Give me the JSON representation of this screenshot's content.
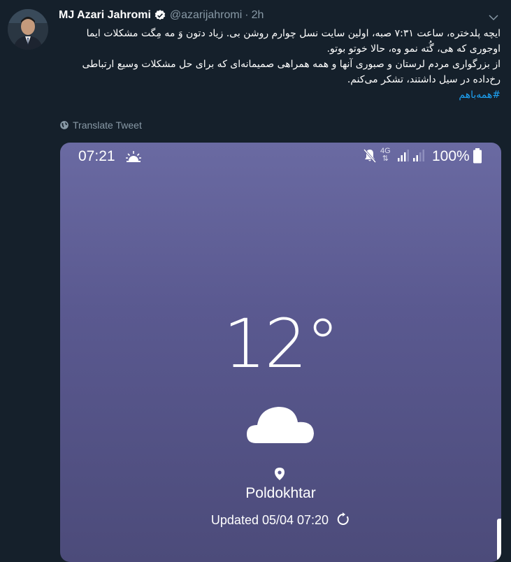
{
  "tweet": {
    "author_name": "MJ Azari Jahromi",
    "handle": "@azarijahromi",
    "separator": "·",
    "time": "2h",
    "text_line1": "ایچه پلدختره، ساعت ۷:۳۱ صبه، اولین سایت نسل چوارم روشن بی. زیاد دتون وَ مه مِگت مشکلات ایما",
    "text_line2": "اوجوری که هی، گُته نمو وه، حالا خوتو بوتو.",
    "text_line3": "از بزرگواری مردم لرستان و صبوری آنها و همه همراهی صمیمانه‌ای که برای حل مشکلات وسیع ارتباطی",
    "text_line4": "رخ‌داده در سیل داشتند، تشکر می‌کنم.",
    "hashtag": "#همه‌باهم",
    "translate_label": "Translate Tweet"
  },
  "phone": {
    "status_time": "07:21",
    "network_label": "4G",
    "battery": "100%",
    "temperature": "12°",
    "location": "Poldokhtar",
    "updated": "Updated 05/04 07:20"
  },
  "colors": {
    "background": "#15202b",
    "link": "#1da1f2",
    "muted": "#8899a6",
    "verified": "#ffffff",
    "weather_top": "#6a6aa2",
    "weather_bottom": "#4c4b7a"
  },
  "icons": {
    "verified": "verified-badge-icon",
    "caret": "chevron-down-icon",
    "globe": "globe-icon",
    "sun": "sunrise-icon",
    "mute": "mute-icon",
    "cloud": "cloud-icon",
    "pin": "location-pin-icon",
    "refresh": "refresh-icon"
  }
}
